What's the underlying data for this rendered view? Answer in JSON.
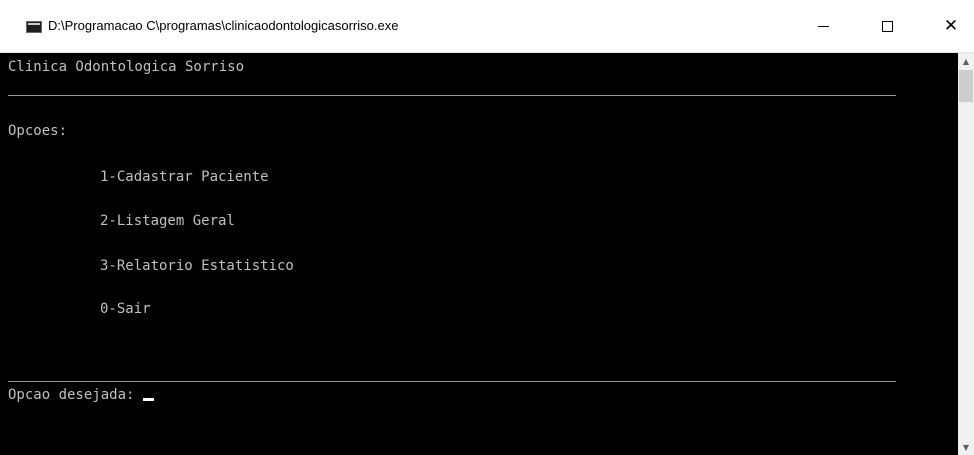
{
  "window": {
    "title": "D:\\Programacao C\\programas\\clinicaodontologicasorriso.exe",
    "minimize_symbol": "—",
    "close_symbol": "✕"
  },
  "console": {
    "header": "Clinica Odontologica Sorriso",
    "options_label": "Opcoes:",
    "options": [
      "1-Cadastrar Paciente",
      "2-Listagem Geral",
      "3-Relatorio Estatistico",
      "0-Sair"
    ],
    "prompt": "Opcao desejada: "
  },
  "scrollbar": {
    "up_arrow": "▲",
    "down_arrow": "▼"
  },
  "colors": {
    "console_bg": "#000000",
    "console_text": "#c0c0c0",
    "titlebar_bg": "#ffffff"
  }
}
